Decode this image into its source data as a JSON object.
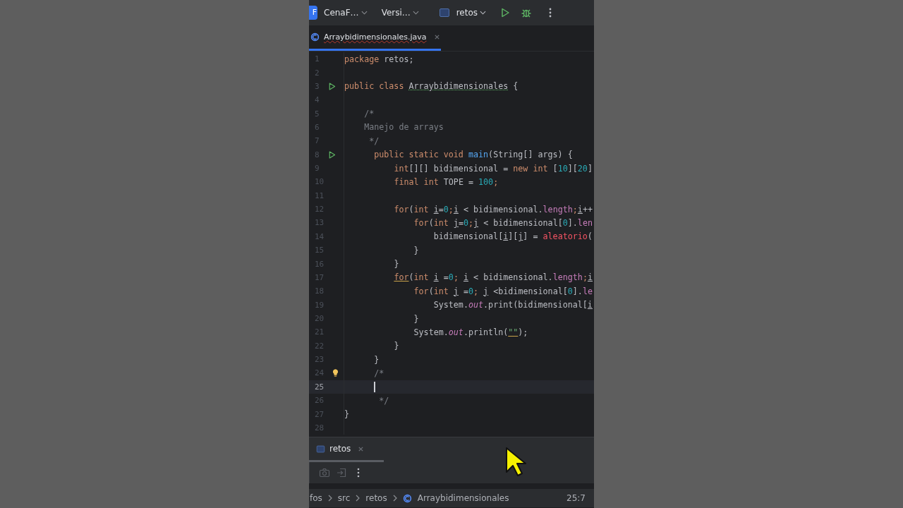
{
  "toolbar": {
    "project_badge": "F",
    "project": "CenaF…",
    "vcs": "Versi…",
    "run_config": "retos"
  },
  "editor_tabs": [
    {
      "label": "Arraybidimensionales.java",
      "selected": true
    }
  ],
  "code_lines": [
    {
      "number": "1",
      "current": false,
      "tokens": [
        {
          "text": "package ",
          "kind": "kw"
        },
        {
          "text": "retos;",
          "kind": "plain"
        }
      ]
    },
    {
      "number": "2",
      "current": false
    },
    {
      "number": "3",
      "kind": "run",
      "current": false,
      "tokens": [
        {
          "text": "public class ",
          "kind": "kw"
        },
        {
          "text": "Arraybidimensionales",
          "kind": "cls"
        },
        {
          "text": " {",
          "kind": "plain"
        }
      ]
    },
    {
      "number": "4",
      "current": false
    },
    {
      "number": "5",
      "current": false,
      "tokens": [
        {
          "text": "    /*",
          "kind": "comment"
        }
      ]
    },
    {
      "number": "6",
      "current": false,
      "tokens": [
        {
          "text": "    Manejo de arrays",
          "kind": "comment"
        }
      ]
    },
    {
      "number": "7",
      "current": false,
      "tokens": [
        {
          "text": "     */",
          "kind": "comment"
        }
      ]
    },
    {
      "number": "8",
      "kind": "run",
      "current": false,
      "tokens": [
        {
          "text": "      public static void ",
          "kind": "kw"
        },
        {
          "text": "main",
          "kind": "fn"
        },
        {
          "text": "(String[] args) {",
          "kind": "plain"
        }
      ]
    },
    {
      "number": "9",
      "current": false,
      "tokens": [
        {
          "text": "          int",
          "kind": "kw"
        },
        {
          "text": "[][] bidimensional = ",
          "kind": "plain"
        },
        {
          "text": "new int",
          "kind": "kw"
        },
        {
          "text": " [",
          "kind": "plain"
        },
        {
          "text": "10",
          "kind": "num"
        },
        {
          "text": "][",
          "kind": "plain"
        },
        {
          "text": "20",
          "kind": "num"
        },
        {
          "text": "]",
          "kind": "plain"
        }
      ]
    },
    {
      "number": "10",
      "current": false,
      "tokens": [
        {
          "text": "          final int",
          "kind": "kw"
        },
        {
          "text": " TOPE = ",
          "kind": "plain"
        },
        {
          "text": "100",
          "kind": "num"
        },
        {
          "text": ";",
          "kind": "kw"
        }
      ]
    },
    {
      "number": "11",
      "current": false
    },
    {
      "number": "12",
      "current": false,
      "tokens": [
        {
          "text": "          for",
          "kind": "kw"
        },
        {
          "text": "(",
          "kind": "plain"
        },
        {
          "text": "int ",
          "kind": "kw"
        },
        {
          "text": "i",
          "kind": "ul"
        },
        {
          "text": "=",
          "kind": "plain"
        },
        {
          "text": "0",
          "kind": "num"
        },
        {
          "text": ";",
          "kind": "kw"
        },
        {
          "text": "i",
          "kind": "ul"
        },
        {
          "text": " < bidimensional.",
          "kind": "plain"
        },
        {
          "text": "length",
          "kind": "field"
        },
        {
          "text": ";",
          "kind": "kw"
        },
        {
          "text": "i",
          "kind": "ul"
        },
        {
          "text": "++",
          "kind": "plain"
        }
      ]
    },
    {
      "number": "13",
      "current": false,
      "tokens": [
        {
          "text": "              for",
          "kind": "kw"
        },
        {
          "text": "(",
          "kind": "plain"
        },
        {
          "text": "int ",
          "kind": "kw"
        },
        {
          "text": "j",
          "kind": "ul"
        },
        {
          "text": "=",
          "kind": "plain"
        },
        {
          "text": "0",
          "kind": "num"
        },
        {
          "text": ";",
          "kind": "kw"
        },
        {
          "text": "j",
          "kind": "ul"
        },
        {
          "text": " < bidimensional[",
          "kind": "plain"
        },
        {
          "text": "0",
          "kind": "num"
        },
        {
          "text": "].",
          "kind": "plain"
        },
        {
          "text": "len",
          "kind": "field"
        }
      ]
    },
    {
      "number": "14",
      "current": false,
      "tokens": [
        {
          "text": "                  bidimensional[",
          "kind": "plain"
        },
        {
          "text": "i",
          "kind": "ul"
        },
        {
          "text": "][",
          "kind": "plain"
        },
        {
          "text": "j",
          "kind": "ul"
        },
        {
          "text": "] = ",
          "kind": "plain"
        },
        {
          "text": "aleatorio",
          "kind": "err"
        },
        {
          "text": "(",
          "kind": "plain"
        }
      ]
    },
    {
      "number": "15",
      "current": false,
      "tokens": [
        {
          "text": "              }",
          "kind": "plain"
        }
      ]
    },
    {
      "number": "16",
      "current": false,
      "tokens": [
        {
          "text": "          }",
          "kind": "plain"
        }
      ]
    },
    {
      "number": "17",
      "current": false,
      "tokens": [
        {
          "text": "          for",
          "kind": "warn"
        },
        {
          "text": "(",
          "kind": "plain"
        },
        {
          "text": "int ",
          "kind": "kw"
        },
        {
          "text": "i",
          "kind": "ul"
        },
        {
          "text": " =",
          "kind": "plain"
        },
        {
          "text": "0",
          "kind": "num"
        },
        {
          "text": "; ",
          "kind": "kw"
        },
        {
          "text": "i",
          "kind": "ul"
        },
        {
          "text": " < bidimensional.",
          "kind": "plain"
        },
        {
          "text": "length",
          "kind": "field"
        },
        {
          "text": ";",
          "kind": "kw"
        },
        {
          "text": "i",
          "kind": "ul"
        }
      ]
    },
    {
      "number": "18",
      "current": false,
      "tokens": [
        {
          "text": "              for",
          "kind": "kw"
        },
        {
          "text": "(",
          "kind": "plain"
        },
        {
          "text": "int ",
          "kind": "kw"
        },
        {
          "text": "j",
          "kind": "ul"
        },
        {
          "text": " =",
          "kind": "plain"
        },
        {
          "text": "0",
          "kind": "num"
        },
        {
          "text": "; ",
          "kind": "kw"
        },
        {
          "text": "j",
          "kind": "ul"
        },
        {
          "text": " <bidimensional[",
          "kind": "plain"
        },
        {
          "text": "0",
          "kind": "num"
        },
        {
          "text": "].",
          "kind": "plain"
        },
        {
          "text": "le",
          "kind": "field"
        }
      ]
    },
    {
      "number": "19",
      "current": false,
      "tokens": [
        {
          "text": "                  System.",
          "kind": "plain"
        },
        {
          "text": "out",
          "kind": "static"
        },
        {
          "text": ".print(bidimensional[",
          "kind": "plain"
        },
        {
          "text": "i",
          "kind": "ul"
        }
      ]
    },
    {
      "number": "20",
      "current": false,
      "tokens": [
        {
          "text": "              }",
          "kind": "plain"
        }
      ]
    },
    {
      "number": "21",
      "current": false,
      "tokens": [
        {
          "text": "              System.",
          "kind": "plain"
        },
        {
          "text": "out",
          "kind": "static"
        },
        {
          "text": ".println(",
          "kind": "plain"
        },
        {
          "text": "\"\"",
          "kind": "strwarn"
        },
        {
          "text": ");",
          "kind": "plain"
        }
      ]
    },
    {
      "number": "22",
      "current": false,
      "tokens": [
        {
          "text": "          }",
          "kind": "plain"
        }
      ]
    },
    {
      "number": "23",
      "current": false,
      "tokens": [
        {
          "text": "      }",
          "kind": "plain"
        }
      ]
    },
    {
      "number": "24",
      "kind": "bulb",
      "current": false,
      "tokens": [
        {
          "text": "      /*",
          "kind": "comment"
        }
      ]
    },
    {
      "number": "25",
      "current": true
    },
    {
      "number": "26",
      "current": false,
      "tokens": [
        {
          "text": "       */",
          "kind": "comment"
        }
      ]
    },
    {
      "number": "27",
      "current": false,
      "tokens": [
        {
          "text": "}",
          "kind": "plain"
        }
      ]
    },
    {
      "number": "28",
      "current": false
    }
  ],
  "tool_window": {
    "tabs": [
      {
        "label": "retos",
        "selected": true
      }
    ]
  },
  "status_bar": {
    "breadcrumbs": [
      {
        "label": "fos",
        "kind": "folder"
      },
      {
        "label": "src",
        "kind": "folder"
      },
      {
        "label": "retos",
        "kind": "folder"
      },
      {
        "label": "Arraybidimensionales",
        "kind": "class"
      }
    ],
    "position": "25:7"
  }
}
